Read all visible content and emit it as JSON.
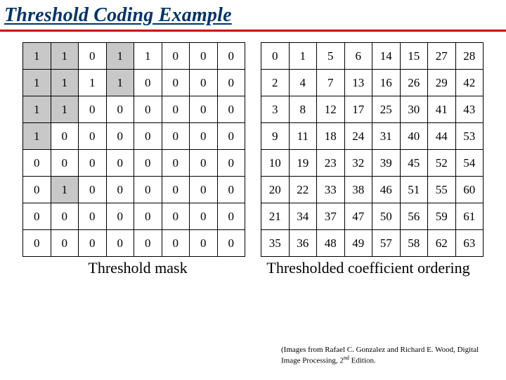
{
  "title": "Threshold Coding Example",
  "captions": {
    "left": "Threshold mask",
    "right": "Thresholded coefficient ordering"
  },
  "mask": [
    [
      {
        "v": 1,
        "s": 1
      },
      {
        "v": 1,
        "s": 1
      },
      {
        "v": 0,
        "s": 0
      },
      {
        "v": 1,
        "s": 1
      },
      {
        "v": 1,
        "s": 0
      },
      {
        "v": 0,
        "s": 0
      },
      {
        "v": 0,
        "s": 0
      },
      {
        "v": 0,
        "s": 0
      }
    ],
    [
      {
        "v": 1,
        "s": 1
      },
      {
        "v": 1,
        "s": 1
      },
      {
        "v": 1,
        "s": 0
      },
      {
        "v": 1,
        "s": 1
      },
      {
        "v": 0,
        "s": 0
      },
      {
        "v": 0,
        "s": 0
      },
      {
        "v": 0,
        "s": 0
      },
      {
        "v": 0,
        "s": 0
      }
    ],
    [
      {
        "v": 1,
        "s": 1
      },
      {
        "v": 1,
        "s": 1
      },
      {
        "v": 0,
        "s": 0
      },
      {
        "v": 0,
        "s": 0
      },
      {
        "v": 0,
        "s": 0
      },
      {
        "v": 0,
        "s": 0
      },
      {
        "v": 0,
        "s": 0
      },
      {
        "v": 0,
        "s": 0
      }
    ],
    [
      {
        "v": 1,
        "s": 1
      },
      {
        "v": 0,
        "s": 0
      },
      {
        "v": 0,
        "s": 0
      },
      {
        "v": 0,
        "s": 0
      },
      {
        "v": 0,
        "s": 0
      },
      {
        "v": 0,
        "s": 0
      },
      {
        "v": 0,
        "s": 0
      },
      {
        "v": 0,
        "s": 0
      }
    ],
    [
      {
        "v": 0,
        "s": 0
      },
      {
        "v": 0,
        "s": 0
      },
      {
        "v": 0,
        "s": 0
      },
      {
        "v": 0,
        "s": 0
      },
      {
        "v": 0,
        "s": 0
      },
      {
        "v": 0,
        "s": 0
      },
      {
        "v": 0,
        "s": 0
      },
      {
        "v": 0,
        "s": 0
      }
    ],
    [
      {
        "v": 0,
        "s": 0
      },
      {
        "v": 1,
        "s": 1
      },
      {
        "v": 0,
        "s": 0
      },
      {
        "v": 0,
        "s": 0
      },
      {
        "v": 0,
        "s": 0
      },
      {
        "v": 0,
        "s": 0
      },
      {
        "v": 0,
        "s": 0
      },
      {
        "v": 0,
        "s": 0
      }
    ],
    [
      {
        "v": 0,
        "s": 0
      },
      {
        "v": 0,
        "s": 0
      },
      {
        "v": 0,
        "s": 0
      },
      {
        "v": 0,
        "s": 0
      },
      {
        "v": 0,
        "s": 0
      },
      {
        "v": 0,
        "s": 0
      },
      {
        "v": 0,
        "s": 0
      },
      {
        "v": 0,
        "s": 0
      }
    ],
    [
      {
        "v": 0,
        "s": 0
      },
      {
        "v": 0,
        "s": 0
      },
      {
        "v": 0,
        "s": 0
      },
      {
        "v": 0,
        "s": 0
      },
      {
        "v": 0,
        "s": 0
      },
      {
        "v": 0,
        "s": 0
      },
      {
        "v": 0,
        "s": 0
      },
      {
        "v": 0,
        "s": 0
      }
    ]
  ],
  "order": [
    [
      0,
      1,
      5,
      6,
      14,
      15,
      27,
      28
    ],
    [
      2,
      4,
      7,
      13,
      16,
      26,
      29,
      42
    ],
    [
      3,
      8,
      12,
      17,
      25,
      30,
      41,
      43
    ],
    [
      9,
      11,
      18,
      24,
      31,
      40,
      44,
      53
    ],
    [
      10,
      19,
      23,
      32,
      39,
      45,
      52,
      54
    ],
    [
      20,
      22,
      33,
      38,
      46,
      51,
      55,
      60
    ],
    [
      21,
      34,
      37,
      47,
      50,
      56,
      59,
      61
    ],
    [
      35,
      36,
      48,
      49,
      57,
      58,
      62,
      63
    ]
  ],
  "credit_html": "(Images from Rafael C. Gonzalez and Richard E. Wood, Digital Image Processing, 2<sup>nd</sup> Edition."
}
